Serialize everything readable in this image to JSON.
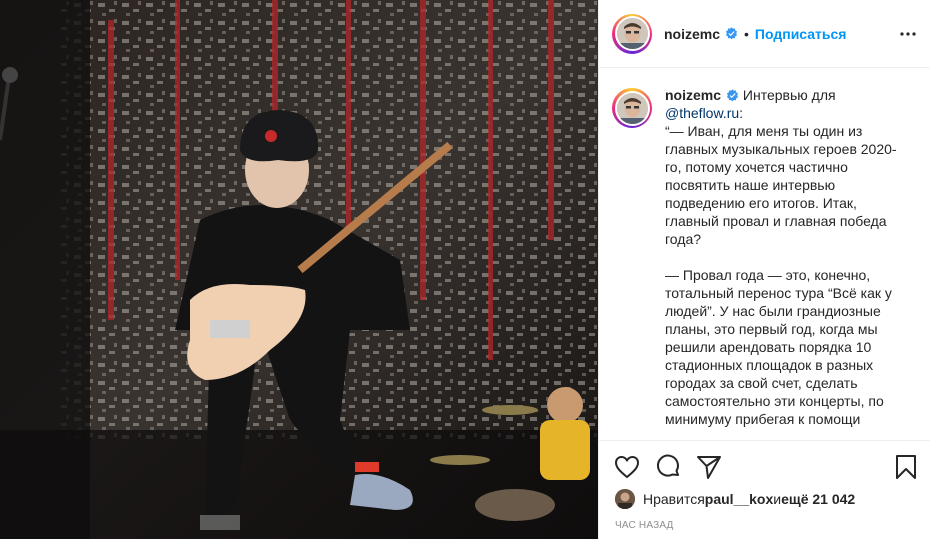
{
  "post": {
    "username": "noizemc",
    "follow_label": "Подписаться",
    "separator": "•"
  },
  "caption": {
    "username": "noizemc",
    "intro": " Интервью для ",
    "mention": "@theflow.ru",
    "intro_end": ":",
    "body": "“— Иван, для меня ты один из главных музыкальных героев 2020-го, потому хочется частично посвятить наше интервью подведению его итогов. Итак, главный провал и главная победа года?\n\n— Провал года — это, конечно, тотальный перенос тура “Всё как у людей”. У нас были грандиозные планы, это первый год, когда мы решили арендовать порядка 10 стадионных площадок в разных городах за свой счет, сделать самостоятельно эти концерты, по минимуму прибегая к помощи"
  },
  "likes": {
    "prefix": "Нравится ",
    "user": "paul__kox",
    "middle": " и ",
    "count": "ещё 21 042"
  },
  "timestamp": "час назад",
  "colors": {
    "follow": "#0095f6",
    "verified": "#3897f0",
    "text": "#262626",
    "muted": "#8e8e8e",
    "divider": "#efefef"
  },
  "icons": [
    "verified-badge-icon",
    "more-options-icon",
    "heart-icon",
    "comment-icon",
    "share-icon",
    "bookmark-icon"
  ]
}
